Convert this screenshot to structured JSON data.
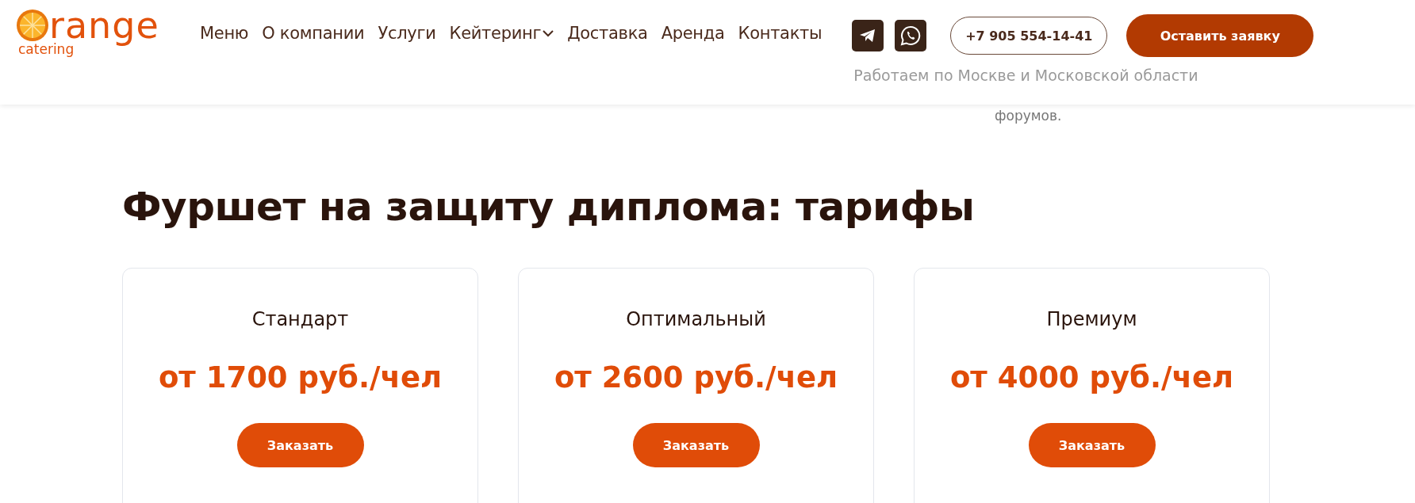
{
  "header": {
    "logo": {
      "word": "range",
      "tagline": "catering"
    },
    "nav": [
      {
        "label": "Меню",
        "dropdown": false
      },
      {
        "label": "О компании",
        "dropdown": false
      },
      {
        "label": "Услуги",
        "dropdown": false
      },
      {
        "label": "Кейтеринг",
        "dropdown": true
      },
      {
        "label": "Доставка",
        "dropdown": false
      },
      {
        "label": "Аренда",
        "dropdown": false
      },
      {
        "label": "Контакты",
        "dropdown": false
      }
    ],
    "socials": [
      {
        "kind": "telegram"
      },
      {
        "kind": "whatsapp"
      }
    ],
    "phone": "+7 905 554-14-41",
    "cta": "Оставить заявку",
    "region_note": "Работаем по Москве и Московской области"
  },
  "scrolled_text": "форумов.",
  "pricing": {
    "title": "Фуршет на защиту диплома: тарифы",
    "tariffs": [
      {
        "name": "Стандарт",
        "price": "от 1700 руб./чел",
        "button": "Заказать"
      },
      {
        "name": "Оптимальный",
        "price": "от 2600 руб./чел",
        "button": "Заказать"
      },
      {
        "name": "Премиум",
        "price": "от 4000 руб./чел",
        "button": "Заказать"
      }
    ]
  }
}
